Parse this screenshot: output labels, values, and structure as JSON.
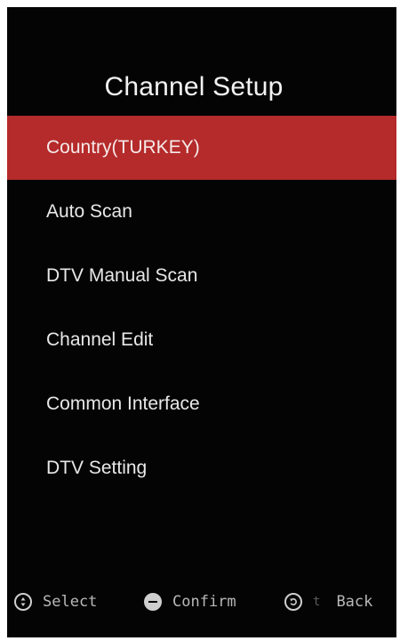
{
  "title": "Channel Setup",
  "menu": {
    "selected_index": 0,
    "items": [
      {
        "label": "Country(TURKEY)"
      },
      {
        "label": "Auto Scan"
      },
      {
        "label": "DTV Manual Scan"
      },
      {
        "label": "Channel Edit"
      },
      {
        "label": "Common Interface"
      },
      {
        "label": "DTV Setting"
      }
    ]
  },
  "footer": {
    "select": {
      "label": "Select",
      "icon": "navigate-icon"
    },
    "confirm": {
      "label": "Confirm",
      "icon": "enter-icon"
    },
    "back": {
      "label": "Back",
      "mark": "t",
      "icon": "return-icon"
    }
  },
  "colors": {
    "background": "#040404",
    "highlight": "#b52a2a",
    "text": "#e8e8e8"
  }
}
